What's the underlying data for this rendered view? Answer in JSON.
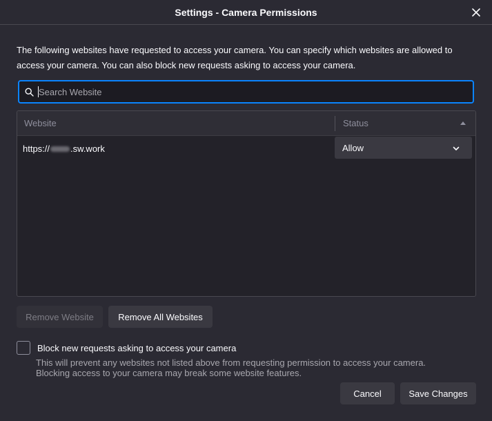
{
  "titlebar": {
    "title": "Settings - Camera Permissions",
    "close_icon": "close-icon"
  },
  "intro": {
    "text": "The following websites have requested to access your camera. You can specify which websites are allowed to access your camera. You can also block new requests asking to access your camera."
  },
  "search": {
    "placeholder": "Search Website",
    "value": "",
    "icon": "search-icon"
  },
  "table": {
    "headers": {
      "website": "Website",
      "status": "Status"
    },
    "rows": [
      {
        "site_prefix": "https://",
        "site_suffix": ".sw.work",
        "status": "Allow"
      }
    ]
  },
  "buttons": {
    "remove_website": "Remove Website",
    "remove_all": "Remove All Websites",
    "cancel": "Cancel",
    "save": "Save Changes"
  },
  "block": {
    "label": "Block new requests asking to access your camera",
    "description_line1": "This will prevent any websites not listed above from requesting permission to access your camera.",
    "description_line2": "Blocking access to your camera may break some website features.",
    "checked": false
  },
  "colors": {
    "accent": "#0a84ff",
    "background": "#2b2a33"
  }
}
